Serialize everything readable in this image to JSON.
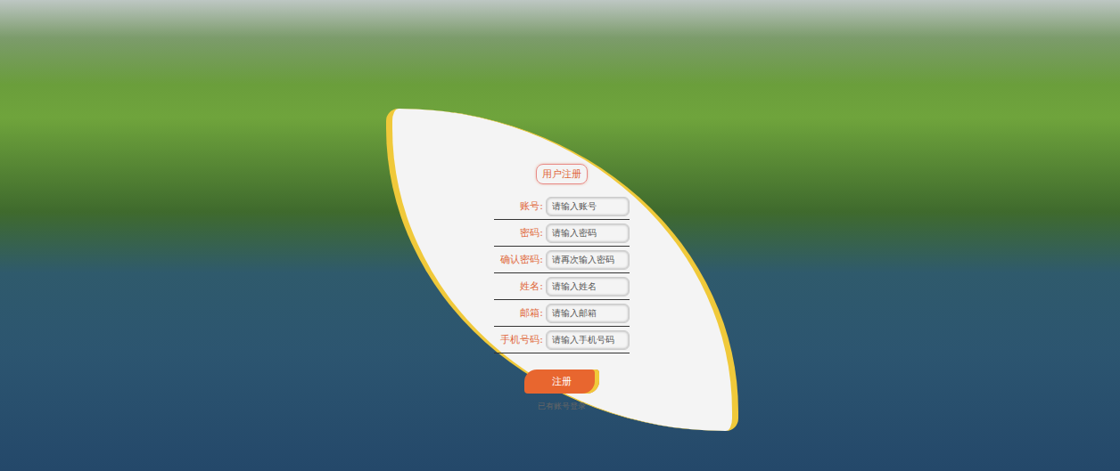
{
  "form": {
    "title": "用户注册",
    "fields": [
      {
        "label": "账号:",
        "placeholder": "请输入账号"
      },
      {
        "label": "密码:",
        "placeholder": "请输入密码"
      },
      {
        "label": "确认密码:",
        "placeholder": "请再次输入密码"
      },
      {
        "label": "姓名:",
        "placeholder": "请输入姓名"
      },
      {
        "label": "邮箱:",
        "placeholder": "请输入邮箱"
      },
      {
        "label": "手机号码:",
        "placeholder": "请输入手机号码"
      }
    ],
    "submit": "注册",
    "login_link": "已有账号登录"
  }
}
